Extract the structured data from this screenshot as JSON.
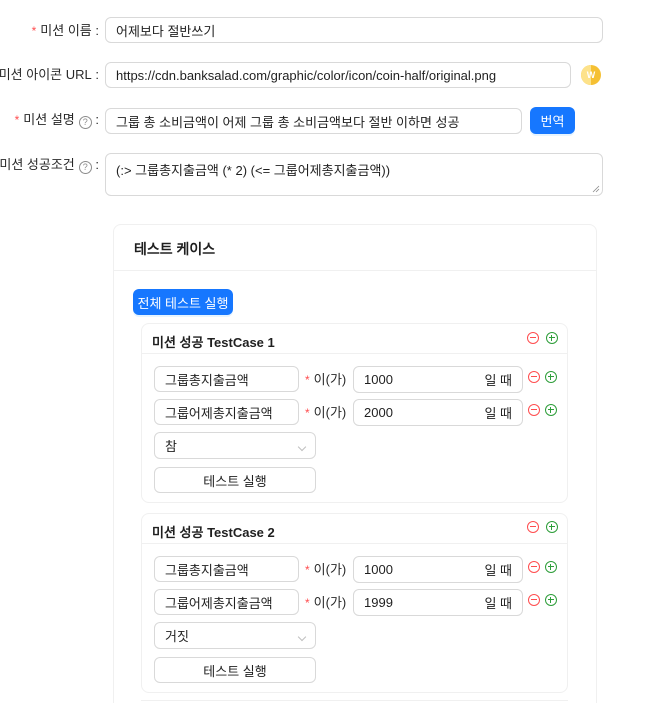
{
  "form": {
    "name_label": "미션 이름",
    "name_value": "어제보다 절반쓰기",
    "icon_url_label": "미션 아이콘 URL",
    "icon_url_value": "https://cdn.banksalad.com/graphic/color/icon/coin-half/original.png",
    "icon_preview": "coin-half-icon",
    "description_label": "미션 설명",
    "description_value": "그룹 총 소비금액이 어제 그룹 총 소비금액보다 절반 이하면 성공",
    "translate_button": "번역",
    "condition_label": "미션 성공조건",
    "condition_value": "(:> 그룹총지출금액 (* 2) (<= 그룹어제총지출금액))",
    "colon": ":",
    "required_mark": "*",
    "help_icon": "?"
  },
  "test_cases": {
    "title": "테스트 케이스",
    "run_all_button": "전체 테스트 실행",
    "cases": [
      {
        "title": "미션 성공 TestCase 1",
        "rows": [
          {
            "variable": "그룹총지출금액",
            "iga": "이(가)",
            "value": "1000",
            "suffix": "일 때"
          },
          {
            "variable": "그룹어제총지출금액",
            "iga": "이(가)",
            "value": "2000",
            "suffix": "일 때"
          }
        ],
        "expected": "참",
        "run_button": "테스트 실행"
      },
      {
        "title": "미션 성공 TestCase 2",
        "rows": [
          {
            "variable": "그룹총지출금액",
            "iga": "이(가)",
            "value": "1000",
            "suffix": "일 때"
          },
          {
            "variable": "그룹어제총지출금액",
            "iga": "이(가)",
            "value": "1999",
            "suffix": "일 때"
          }
        ],
        "expected": "거짓",
        "run_button": "테스트 실행"
      }
    ]
  },
  "colors": {
    "primary": "#1677ff",
    "required": "#ff4d4f",
    "remove": "#ff4d4f",
    "add": "#2e9e3a",
    "coin": "#f5c033"
  }
}
